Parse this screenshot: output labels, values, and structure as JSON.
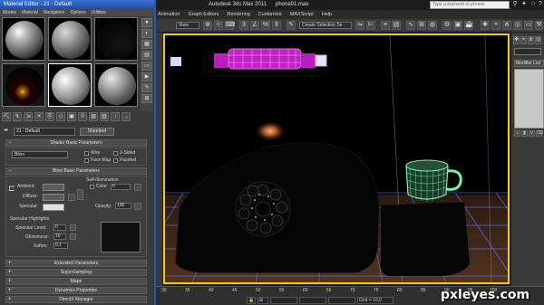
{
  "material_editor": {
    "title": "Material Editor - 21 - Default",
    "menu": [
      "Modes",
      "Material",
      "Navigation",
      "Options",
      "Utilities"
    ],
    "material_name": "21 - Default",
    "material_type": "Standard",
    "shader_basic": {
      "header": "Shader Basic Parameters",
      "shader": "Blinn",
      "wire": "Wire",
      "two_sided": "2-Sided",
      "face_map": "Face Map",
      "faceted": "Faceted"
    },
    "blinn_basic": {
      "header": "Blinn Basic Parameters",
      "self_illumination": "Self-Illumination",
      "color_label": "Color",
      "color_value": "0",
      "ambient": "Ambient:",
      "diffuse": "Diffuse:",
      "specular": "Specular:",
      "opacity_label": "Opacity:",
      "opacity_value": "100",
      "highlights_header": "Specular Highlights",
      "specular_level_label": "Specular Level:",
      "specular_level_value": "0",
      "glossiness_label": "Glossiness:",
      "glossiness_value": "10",
      "soften_label": "Soften:",
      "soften_value": "0.1"
    },
    "rollouts": [
      "Extended Parameters",
      "SuperSampling",
      "Maps",
      "Dynamics Properties",
      "DirectX Manager"
    ]
  },
  "max": {
    "app_title": "Autodesk 3ds Max  2011",
    "file_name": "phone01.max",
    "search_placeholder": "Type a keyword or phrase",
    "menu": [
      "Animation",
      "Graph Editors",
      "Rendering",
      "Customize",
      "MAXScript",
      "Help"
    ],
    "view_dropdown": "View",
    "selection_set": "Create Selection Se"
  },
  "command_panel": {
    "modifier_list": "Modifier List"
  },
  "timeline": {
    "ticks": [
      "30",
      "35",
      "40",
      "45",
      "50",
      "55",
      "60",
      "65",
      "70",
      "75",
      "80",
      "85",
      "90",
      "95",
      "100"
    ],
    "grid_label": "Grid = 10,0"
  },
  "watermark": "pxleyes.com",
  "colors": {
    "title_blue": "#2a5fc4",
    "viewport_border": "#f0d000",
    "phone_cord": "#d42ad8",
    "mug_wire": "#79f2a9",
    "grid_lines": "#5b7cff"
  }
}
